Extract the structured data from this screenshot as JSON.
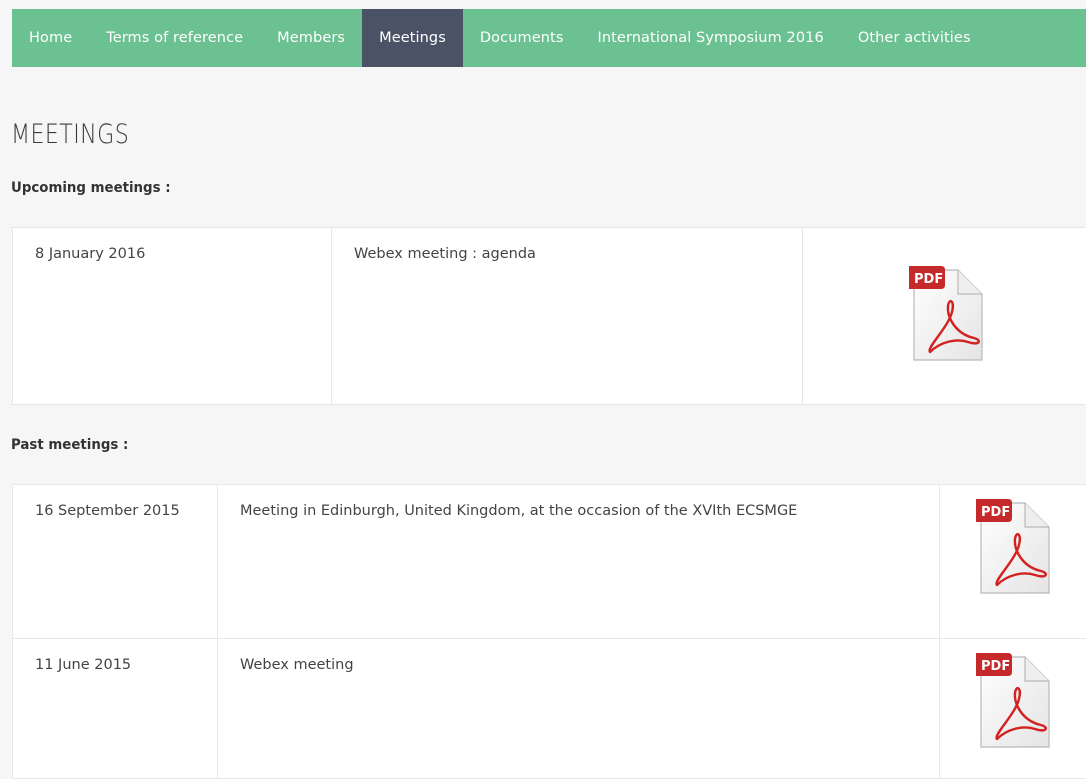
{
  "nav": {
    "items": [
      {
        "label": "Home",
        "name": "nav-home"
      },
      {
        "label": "Terms of reference",
        "name": "nav-terms-of-reference"
      },
      {
        "label": "Members",
        "name": "nav-members"
      },
      {
        "label": "Meetings",
        "name": "nav-meetings"
      },
      {
        "label": "Documents",
        "name": "nav-documents"
      },
      {
        "label": "International Symposium 2016",
        "name": "nav-international-symposium-2016"
      },
      {
        "label": "Other activities",
        "name": "nav-other-activities"
      }
    ],
    "active": "Meetings",
    "bg_color": "#6cc192",
    "active_color": "#4a5266"
  },
  "page": {
    "title": "MEETINGS"
  },
  "upcoming": {
    "heading": "Upcoming meetings :",
    "rows": [
      {
        "date": "8 January 2016",
        "description": "Webex meeting : agenda",
        "icon": "pdf-icon"
      }
    ]
  },
  "past": {
    "heading": "Past meetings :",
    "rows": [
      {
        "date": "16 September 2015",
        "description": "Meeting in Edinburgh, United Kingdom, at the occasion of the XVIth ECSMGE",
        "icon": "pdf-icon"
      },
      {
        "date": "11 June 2015",
        "description": "Webex meeting",
        "icon": "pdf-icon"
      }
    ]
  },
  "pdf_badge_text": "PDF"
}
